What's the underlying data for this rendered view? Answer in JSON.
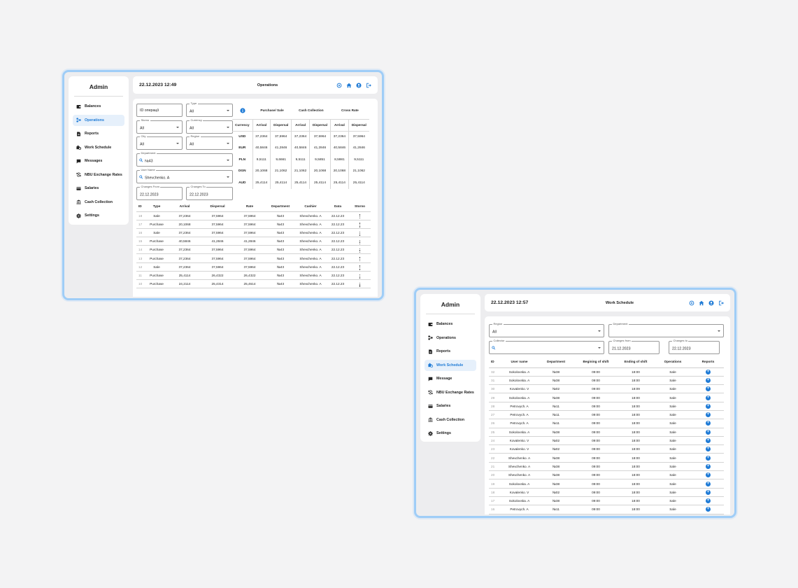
{
  "colors": {
    "accent": "#1f7bd6",
    "frame": "#9fcdf7",
    "active_bg": "#e6f0fb"
  },
  "window1": {
    "brand": "Admin",
    "datetime": "22.12.2023 12:49",
    "title": "Operations",
    "nav": [
      {
        "label": "Balances",
        "icon": "wallet-icon",
        "active": false
      },
      {
        "label": "Operations",
        "icon": "operations-icon",
        "active": true
      },
      {
        "label": "Reports",
        "icon": "document-icon",
        "active": false
      },
      {
        "label": "Work Schedule",
        "icon": "work-schedule-icon",
        "active": false
      },
      {
        "label": "Messages",
        "icon": "message-icon",
        "active": false
      },
      {
        "label": "NBU Exchange Rates",
        "icon": "exchange-icon",
        "active": false
      },
      {
        "label": "Salaries",
        "icon": "card-icon",
        "active": false
      },
      {
        "label": "Cash Collection",
        "icon": "bank-icon",
        "active": false
      },
      {
        "label": "Settings",
        "icon": "gear-icon",
        "active": false
      }
    ],
    "filters": {
      "id_placeholder": "ID операції",
      "type_label": "Type",
      "type_value": "All",
      "storno_label": "Storno",
      "storno_value": "All",
      "currency_label": "Currency",
      "currency_value": "All",
      "city_label": "City",
      "city_value": "All",
      "region_label": "Region",
      "region_value": "All",
      "department_label": "Department",
      "department_value": "№43",
      "user_label": "User Name",
      "user_value": "Shevchenko. A",
      "from_label": "Changes From",
      "from_value": "22.12.2023",
      "to_label": "Changes To",
      "to_value": "22.12.2023"
    },
    "rates": {
      "groups": [
        "Purchase/ Sale",
        "Cash Collection",
        "Cross Rate"
      ],
      "sub_headers": [
        "Currency",
        "Arrival",
        "Dispersal",
        "Arrival",
        "Dispersal",
        "Arrival",
        "Dispersal"
      ],
      "rows": [
        [
          "USD",
          "37,2364",
          "37,5964",
          "37,2364",
          "37,5964",
          "37,2364",
          "37,5964"
        ],
        [
          "EUR",
          "40,5846",
          "41,2846",
          "40,5846",
          "41,2846",
          "40,5846",
          "41,2846"
        ],
        [
          "PLN",
          "9,5111",
          "9,6661",
          "9,5111",
          "9,5851",
          "8,5981",
          "9,5111"
        ],
        [
          "DGN",
          "20,1068",
          "21,1062",
          "21,1062",
          "20,1068",
          "20,1068",
          "21,1062"
        ],
        [
          "AUD",
          "25,4114",
          "25,4114",
          "25,4114",
          "25,4114",
          "25,4114",
          "25,4114"
        ]
      ]
    },
    "ops": {
      "headers": [
        "ID",
        "Type",
        "Arrival",
        "Dispersal",
        "Rate",
        "Department",
        "Cashier",
        "Data",
        "Storno"
      ],
      "rows": [
        [
          "18",
          "Sale",
          "37,2364",
          "37,5964",
          "37,5964",
          "№43",
          "Shevchenko. A",
          "22.12.23"
        ],
        [
          "17",
          "Purchase",
          "20,1068",
          "37,5964",
          "37,5964",
          "№43",
          "Shevchenko. A",
          "22.12.23"
        ],
        [
          "16",
          "Sale",
          "37,2364",
          "37,5964",
          "37,5964",
          "№43",
          "Shevchenko. A",
          "22.12.23"
        ],
        [
          "15",
          "Purchase",
          "40,5846",
          "41,2846",
          "41,2846",
          "№43",
          "Shevchenko. A",
          "22.12.23"
        ],
        [
          "14",
          "Purchase",
          "37,2364",
          "37,5964",
          "37,5964",
          "№43",
          "Shevchenko. A",
          "22.12.23"
        ],
        [
          "13",
          "Purchase",
          "37,2364",
          "37,5964",
          "37,5964",
          "№43",
          "Shevchenko. A",
          "22.12.23"
        ],
        [
          "12",
          "Sale",
          "37,2364",
          "37,5964",
          "37,5964",
          "№43",
          "Shevchenko. A",
          "22.12.23"
        ],
        [
          "11",
          "Purchase",
          "25,4114",
          "26,4322",
          "26,4322",
          "№43",
          "Shevchenko. A",
          "22.12.23"
        ],
        [
          "10",
          "Purchase",
          "24,2114",
          "25,4314",
          "25,4614",
          "№43",
          "Shevchenko. A",
          "22.12.23"
        ]
      ]
    }
  },
  "window2": {
    "brand": "Admin",
    "datetime": "22.12.2023 12:57",
    "title": "Work Schedule",
    "nav": [
      {
        "label": "Balances",
        "icon": "wallet-icon",
        "active": false
      },
      {
        "label": "Operations",
        "icon": "operations-icon",
        "active": false
      },
      {
        "label": "Reports",
        "icon": "document-icon",
        "active": false
      },
      {
        "label": "Work Schedule",
        "icon": "work-schedule-icon",
        "active": true
      },
      {
        "label": "Message",
        "icon": "message-icon",
        "active": false
      },
      {
        "label": "NBU Exchange Rates",
        "icon": "exchange-icon",
        "active": false
      },
      {
        "label": "Salaries",
        "icon": "card-icon",
        "active": false
      },
      {
        "label": "Cash Collection",
        "icon": "bank-icon",
        "active": false
      },
      {
        "label": "Settings",
        "icon": "gear-icon",
        "active": false
      }
    ],
    "filters": {
      "region_label": "Region",
      "region_value": "All",
      "department_label": "Department",
      "department_value": "",
      "collector_label": "Collector",
      "collector_value": "",
      "from_label": "Changes from",
      "from_value": "21.12.2023",
      "to_label": "Changes to",
      "to_value": "22.12.2023"
    },
    "schedule": {
      "headers": [
        "ID",
        "User name",
        "Department",
        "Begining of shift",
        "Ending of shift",
        "Operations",
        "Reports"
      ],
      "rows": [
        [
          "32",
          "Sokolovska. A",
          "№38",
          "09:00",
          "18:00",
          "Sale"
        ],
        [
          "31",
          "Sokolovska. A",
          "№38",
          "09:00",
          "18:00",
          "Sale"
        ],
        [
          "30",
          "Kovalenko. V",
          "№02",
          "09:00",
          "18:09",
          "Sale"
        ],
        [
          "29",
          "Sokolovska. A",
          "№38",
          "09:00",
          "18:00",
          "Sale"
        ],
        [
          "28",
          "Petrovych. A",
          "№11",
          "09:00",
          "18:00",
          "Sale"
        ],
        [
          "27",
          "Petrovych. A",
          "№11",
          "09:00",
          "18:00",
          "Sale"
        ],
        [
          "26",
          "Petrovych. A",
          "№11",
          "09:00",
          "18:00",
          "Sale"
        ],
        [
          "25",
          "Sokolovska. A",
          "№38",
          "09:00",
          "18:00",
          "Sale"
        ],
        [
          "24",
          "Kovalenko. V",
          "№02",
          "09:00",
          "18:00",
          "Sale"
        ],
        [
          "23",
          "Kovalenko. V",
          "№02",
          "09:00",
          "18:00",
          "Sale"
        ],
        [
          "22",
          "Shevchenko. A",
          "№38",
          "09:00",
          "18:00",
          "Sale"
        ],
        [
          "21",
          "Shevchenko. A",
          "№38",
          "09:00",
          "18:00",
          "Sale"
        ],
        [
          "20",
          "Shevchenko. A",
          "№38",
          "09:00",
          "18:00",
          "Sale"
        ],
        [
          "19",
          "Sokolovska. A",
          "№38",
          "09:00",
          "18:00",
          "Sale"
        ],
        [
          "18",
          "Kovalenko. V",
          "№02",
          "09:00",
          "18:00",
          "Sale"
        ],
        [
          "17",
          "Sokolovska. A",
          "№38",
          "09:00",
          "18:00",
          "Sale"
        ],
        [
          "16",
          "Petrovych. A",
          "№11",
          "09:00",
          "18:00",
          "Sale"
        ]
      ]
    }
  }
}
